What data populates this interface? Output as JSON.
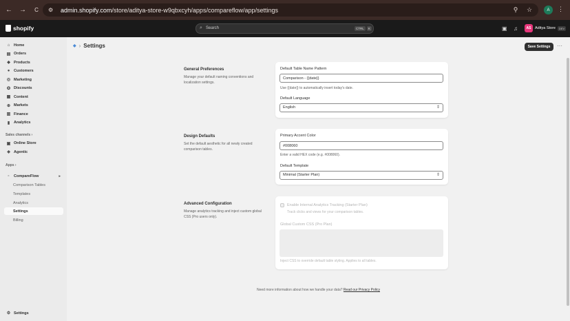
{
  "browser": {
    "back": "←",
    "forward": "→",
    "reload": "C",
    "url_host": "admin.shopify.com",
    "url_path": "/store/aditya-store-w9qbxcyh/apps/compareflow/app/settings",
    "profile_initial": "A"
  },
  "topbar": {
    "brand": "shopify",
    "search_placeholder": "Search",
    "shortcut_1": "CTRL",
    "shortcut_2": "K",
    "store_initials": "AS",
    "store_name": "Aditya Store",
    "store_badge": "DEV"
  },
  "sidebar": {
    "items": [
      {
        "label": "Home"
      },
      {
        "label": "Orders"
      },
      {
        "label": "Products"
      },
      {
        "label": "Customers"
      },
      {
        "label": "Marketing"
      },
      {
        "label": "Discounts"
      },
      {
        "label": "Content"
      },
      {
        "label": "Markets"
      },
      {
        "label": "Finance"
      },
      {
        "label": "Analytics"
      }
    ],
    "sales_channels_heading": "Sales channels",
    "channels": [
      {
        "label": "Online Store"
      },
      {
        "label": "Agentic"
      }
    ],
    "apps_heading": "Apps",
    "app_name": "CompareFlow",
    "app_items": [
      {
        "label": "Comparison Tables"
      },
      {
        "label": "Templates"
      },
      {
        "label": "Analytics"
      },
      {
        "label": "Settings"
      },
      {
        "label": "Billing"
      }
    ],
    "bottom_settings": "Settings"
  },
  "page": {
    "title": "Settings",
    "separator": "›",
    "save_label": "Save Settings",
    "more": "···"
  },
  "sections": {
    "general": {
      "title": "General Preferences",
      "description": "Manage your default naming conventions and localization settings.",
      "table_name_label": "Default Table Name Pattern",
      "table_name_value": "Comparison - {{date}}",
      "table_name_help": "Use {{date}} to automatically insert today's date.",
      "language_label": "Default Language",
      "language_value": "English"
    },
    "design": {
      "title": "Design Defaults",
      "description": "Set the default aesthetic for all newly created comparison tables.",
      "accent_label": "Primary Accent Color",
      "accent_value": "#008060",
      "accent_help": "Enter a valid HEX code (e.g. #008060).",
      "template_label": "Default Template",
      "template_value": "Minimal (Starter Plan)"
    },
    "advanced": {
      "title": "Advanced Configuration",
      "description": "Manage analytics tracking and inject custom global CSS (Pro users only).",
      "tracking_label": "Enable Internal Analytics Tracking (Starter Plan)",
      "tracking_help": "Track clicks and views for your comparison tables.",
      "css_label": "Global Custom CSS (Pro Plan)",
      "css_help": "Inject CSS to override default table styling. Applies to all tables."
    }
  },
  "footer": {
    "text": "Need more information about how we handle your data?",
    "link": "Read our Privacy Policy"
  }
}
